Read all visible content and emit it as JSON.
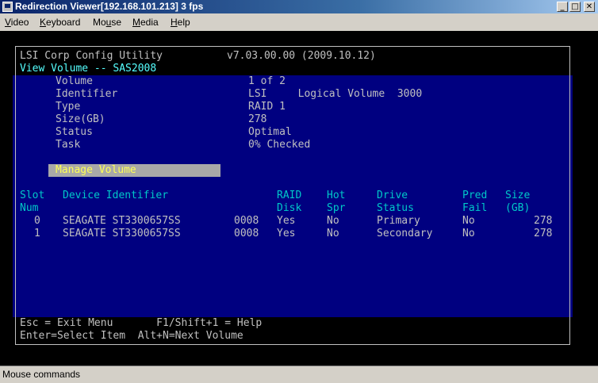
{
  "window": {
    "title": "Redirection Viewer[192.168.101.213]  3 fps",
    "min_glyph": "_",
    "max_glyph": "□",
    "close_glyph": "✕"
  },
  "menu": [
    {
      "hot": "V",
      "rest": "ideo"
    },
    {
      "hot": "K",
      "rest": "eyboard"
    },
    {
      "pre": "Mo",
      "hot": "u",
      "rest": "se"
    },
    {
      "hot": "M",
      "rest": "edia"
    },
    {
      "hot": "H",
      "rest": "elp"
    }
  ],
  "bios": {
    "header": {
      "app": "LSI Corp Config Utility",
      "version": "v7.03.00.00 (2009.10.12)",
      "screen": "View Volume -- SAS2008"
    },
    "props": [
      {
        "label": "Volume",
        "value": "1 of 2"
      },
      {
        "label": "Identifier",
        "value": "LSI     Logical Volume  3000"
      },
      {
        "label": "Type",
        "value": "RAID 1"
      },
      {
        "label": "Size(GB)",
        "value": "278"
      },
      {
        "label": "Status",
        "value": "Optimal"
      },
      {
        "label": "Task",
        "value": "0% Checked"
      }
    ],
    "manage_label": "Manage Volume",
    "columns": {
      "slot": [
        "Slot",
        "Num"
      ],
      "device": [
        "Device Identifier",
        ""
      ],
      "raid": [
        "RAID",
        "Disk"
      ],
      "hot": [
        "Hot",
        "Spr"
      ],
      "drive": [
        "Drive",
        "Status"
      ],
      "pred": [
        "Pred",
        "Fail"
      ],
      "size": [
        "Size",
        "(GB)"
      ]
    },
    "rows": [
      {
        "slot": "0",
        "device": "SEAGATE ST3300657SS",
        "rev": "0008",
        "raid": "Yes",
        "hot": "No",
        "status": "Primary",
        "pred": "No",
        "size": "278"
      },
      {
        "slot": "1",
        "device": "SEAGATE ST3300657SS",
        "rev": "0008",
        "raid": "Yes",
        "hot": "No",
        "status": "Secondary",
        "pred": "No",
        "size": "278"
      }
    ],
    "footer": {
      "line1": "Esc = Exit Menu       F1/Shift+1 = Help",
      "line2": "Enter=Select Item  Alt+N=Next Volume"
    }
  },
  "status_text": "Mouse commands"
}
